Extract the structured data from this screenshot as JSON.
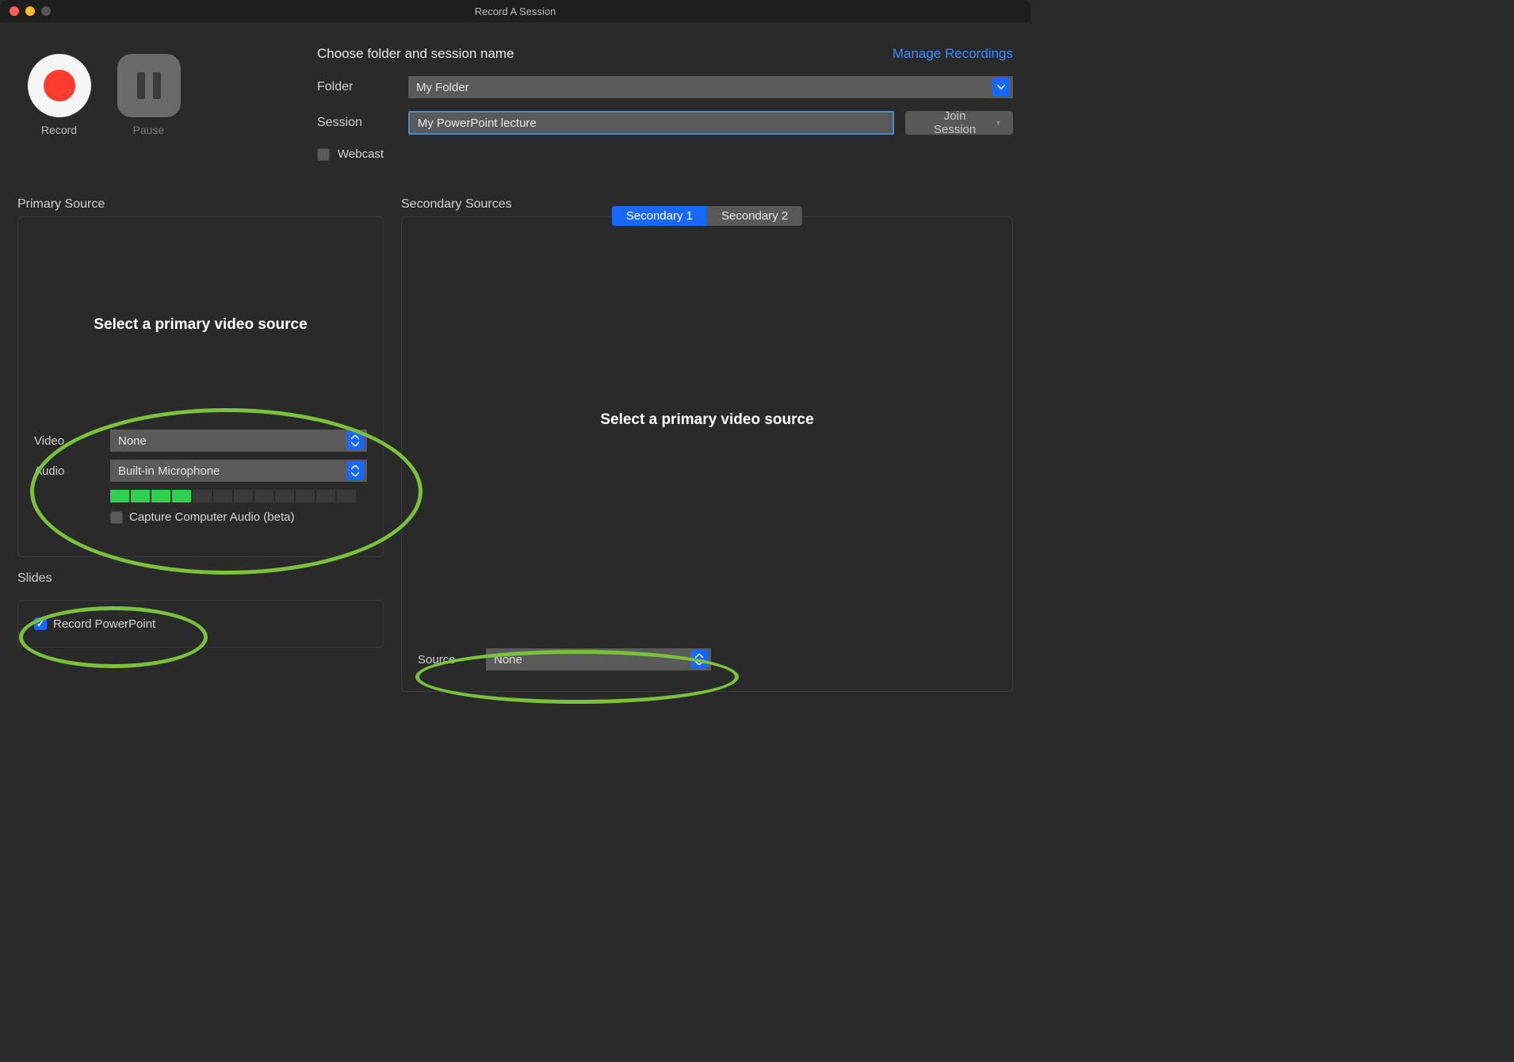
{
  "window": {
    "title": "Record A Session"
  },
  "controls": {
    "record_label": "Record",
    "pause_label": "Pause"
  },
  "form": {
    "heading": "Choose folder and session name",
    "manage_link": "Manage Recordings",
    "folder_label": "Folder",
    "folder_value": "My Folder",
    "session_label": "Session",
    "session_value": "My PowerPoint lecture",
    "join_label": "Join Session",
    "webcast_label": "Webcast",
    "webcast_checked": false
  },
  "primary": {
    "section_title": "Primary Source",
    "placeholder": "Select a primary video source",
    "video_label": "Video",
    "video_value": "None",
    "audio_label": "Audio",
    "audio_value": "Built-in Microphone",
    "audio_level": {
      "on": 4,
      "total": 12
    },
    "capture_audio_label": "Capture Computer Audio (beta)",
    "capture_audio_checked": false
  },
  "slides": {
    "section_title": "Slides",
    "record_pp_label": "Record PowerPoint",
    "record_pp_checked": true
  },
  "secondary": {
    "section_title": "Secondary Sources",
    "tabs": [
      {
        "label": "Secondary 1",
        "active": true
      },
      {
        "label": "Secondary 2",
        "active": false
      }
    ],
    "placeholder": "Select a primary video source",
    "source_label": "Source",
    "source_value": "None"
  }
}
